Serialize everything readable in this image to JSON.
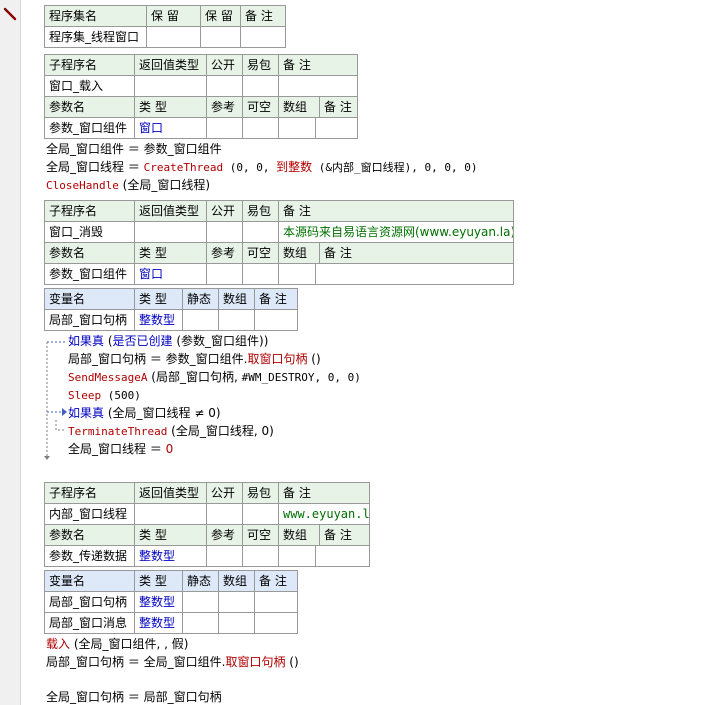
{
  "assembly_table": {
    "headers": [
      "程序集名",
      "保 留",
      "保 留",
      "备 注"
    ],
    "row": [
      "程序集_线程窗口",
      "",
      "",
      ""
    ]
  },
  "sub1": {
    "sub_headers": [
      "子程序名",
      "返回值类型",
      "公开",
      "易包",
      "备 注"
    ],
    "sub_row": [
      "窗口_载入",
      "",
      "",
      "",
      ""
    ],
    "param_headers": [
      "参数名",
      "类 型",
      "参考",
      "可空",
      "数组",
      "备 注"
    ],
    "param_row": [
      "参数_窗口组件",
      "窗口",
      "",
      "",
      "",
      ""
    ],
    "code": {
      "l1_a": "全局_窗口组件 ＝ 参数_窗口组件",
      "l2_a": "全局_窗口线程 ＝ ",
      "l2_fn": "CreateThread",
      "l2_b": " (0, 0, ",
      "l2_c": "到整数",
      "l2_d": " (&内部_窗口线程), 0, 0, 0)",
      "l3_fn": "CloseHandle",
      "l3_b": " (全局_窗口线程)"
    }
  },
  "sub2": {
    "sub_headers": [
      "子程序名",
      "返回值类型",
      "公开",
      "易包",
      "备 注"
    ],
    "sub_row": [
      "窗口_消毁",
      "",
      "",
      "",
      "本源码来自易语言资源网(www.eyuyan.la)"
    ],
    "param_headers": [
      "参数名",
      "类 型",
      "参考",
      "可空",
      "数组",
      "备 注"
    ],
    "param_row": [
      "参数_窗口组件",
      "窗口",
      "",
      "",
      "",
      ""
    ],
    "var_headers": [
      "变量名",
      "类 型",
      "静态",
      "数组",
      "备 注"
    ],
    "var_row": [
      "局部_窗口句柄",
      "整数型",
      "",
      "",
      ""
    ],
    "code": {
      "if1_kw": "如果真",
      "if1_b": " (",
      "if1_c": "是否已创建",
      "if1_d": " (参数_窗口组件))",
      "l1_a": "局部_窗口句柄 ＝ 参数_窗口组件.",
      "l1_b": "取窗口句柄",
      "l1_c": " ()",
      "l2_fn": "SendMessageA",
      "l2_b": " (局部_窗口句柄, ",
      "l2_c": "#WM_DESTROY",
      "l2_d": ", 0, 0)",
      "l3_fn": "Sleep",
      "l3_b": " (500)",
      "if2_kw": "如果真",
      "if2_b": " (全局_窗口线程 ≠ 0)",
      "l4_fn": "TerminateThread",
      "l4_b": " (全局_窗口线程, 0)",
      "l5_a": "全局_窗口线程 ＝ ",
      "l5_b": "0"
    }
  },
  "sub3": {
    "sub_headers": [
      "子程序名",
      "返回值类型",
      "公开",
      "易包",
      "备 注"
    ],
    "sub_row": [
      "内部_窗口线程",
      "",
      "",
      "",
      "www.eyuyan.la"
    ],
    "param_headers": [
      "参数名",
      "类 型",
      "参考",
      "可空",
      "数组",
      "备 注"
    ],
    "param_row": [
      "参数_传递数据",
      "整数型",
      "",
      "",
      "",
      ""
    ],
    "var_headers": [
      "变量名",
      "类 型",
      "静态",
      "数组",
      "备 注"
    ],
    "var_rows": [
      [
        "局部_窗口句柄",
        "整数型",
        "",
        "",
        ""
      ],
      [
        "局部_窗口消息",
        "整数型",
        "",
        "",
        ""
      ]
    ],
    "code": {
      "l1_fn": "载入",
      "l1_b": " (全局_窗口组件, , 假)",
      "l2_a": "局部_窗口句柄 ＝ 全局_窗口组件.",
      "l2_b": "取窗口句柄",
      "l2_c": " ()",
      "l3_a": "全局_窗口句柄 ＝ 局部_窗口句柄"
    }
  }
}
